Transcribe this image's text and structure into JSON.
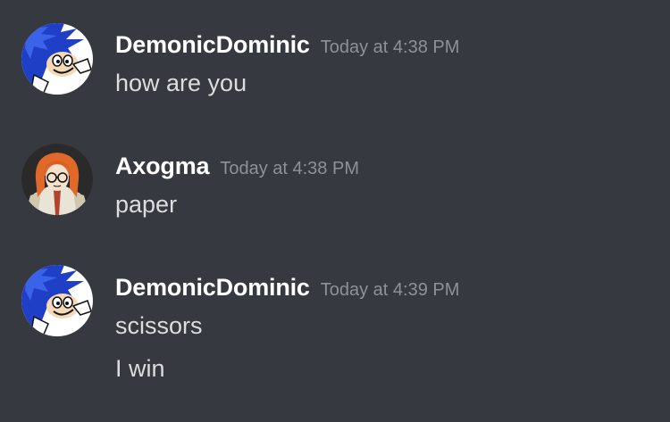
{
  "messages": [
    {
      "author": "DemonicDominic",
      "avatar_icon": "sonic-avatar-icon",
      "timestamp": "Today at 4:38 PM",
      "lines": [
        "how are you"
      ]
    },
    {
      "author": "Axogma",
      "avatar_icon": "anime-girl-avatar-icon",
      "timestamp": "Today at 4:38 PM",
      "lines": [
        "paper"
      ]
    },
    {
      "author": "DemonicDominic",
      "avatar_icon": "sonic-avatar-icon",
      "timestamp": "Today at 4:39 PM",
      "lines": [
        "scissors",
        "I win"
      ]
    }
  ],
  "colors": {
    "background": "#36393f",
    "username": "#ffffff",
    "timestamp": "#8e9297",
    "message_text": "#dcddde"
  }
}
